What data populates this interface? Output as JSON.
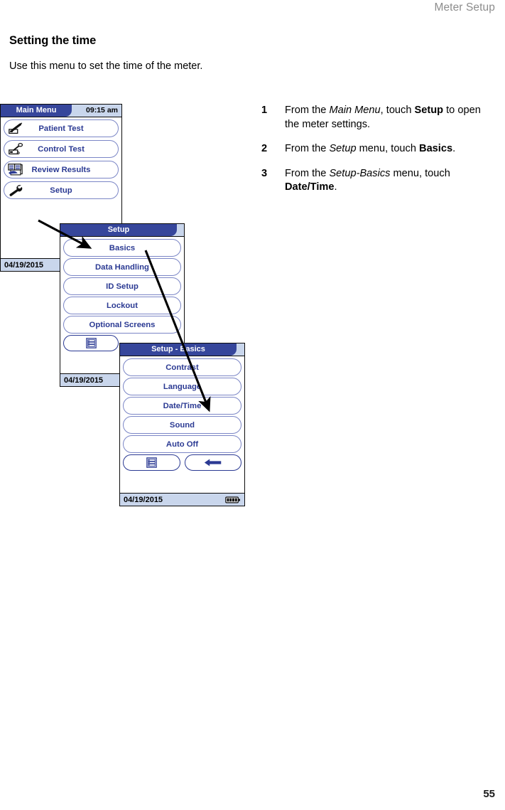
{
  "page": {
    "running_head": "Meter Setup",
    "number": "55",
    "section_title": "Setting the time",
    "intro": "Use this menu to set the time of the meter."
  },
  "steps": [
    {
      "num": "1",
      "parts": [
        {
          "t": "From the ",
          "s": "plain"
        },
        {
          "t": "Main Menu",
          "s": "italic"
        },
        {
          "t": ", touch ",
          "s": "plain"
        },
        {
          "t": "Setup",
          "s": "bold"
        },
        {
          "t": " to open the meter settings.",
          "s": "plain"
        }
      ]
    },
    {
      "num": "2",
      "parts": [
        {
          "t": "From the ",
          "s": "plain"
        },
        {
          "t": "Setup",
          "s": "italic"
        },
        {
          "t": " menu, touch ",
          "s": "plain"
        },
        {
          "t": "Basics",
          "s": "bold"
        },
        {
          "t": ".",
          "s": "plain"
        }
      ]
    },
    {
      "num": "3",
      "parts": [
        {
          "t": "From the ",
          "s": "plain"
        },
        {
          "t": "Setup-Basics",
          "s": "italic"
        },
        {
          "t": " menu, touch ",
          "s": "plain"
        },
        {
          "t": "Date/Time",
          "s": "bold"
        },
        {
          "t": ".",
          "s": "plain"
        }
      ]
    }
  ],
  "colors": {
    "title_bar": "#36469b",
    "title_bar_bg": "#c9d6ec",
    "button_text": "#2b3a93",
    "button_border": "#7b86c6",
    "status_bar": "#c9d6ec",
    "running_head": "#8d8d8d"
  },
  "screens": [
    {
      "id": "main",
      "title": "Main Menu",
      "clock": "09:15 am",
      "date": "04/19/2015",
      "has_battery": false,
      "buttons": [
        {
          "label": "Patient Test",
          "icon": "lancet-strip-icon"
        },
        {
          "label": "Control Test",
          "icon": "control-solution-strip-icon"
        },
        {
          "label": "Review Results",
          "icon": "logbook-icon"
        },
        {
          "label": "Setup",
          "icon": "wrench-icon"
        }
      ],
      "icon_buttons": []
    },
    {
      "id": "setup",
      "title": "Setup",
      "clock": "",
      "date": "04/19/2015",
      "has_battery": false,
      "buttons": [
        {
          "label": "Basics",
          "icon": ""
        },
        {
          "label": "Data Handling",
          "icon": ""
        },
        {
          "label": "ID Setup",
          "icon": ""
        },
        {
          "label": "Lockout",
          "icon": ""
        },
        {
          "label": "Optional Screens",
          "icon": ""
        }
      ],
      "icon_buttons": [
        {
          "icon": "main-menu-list-icon"
        }
      ]
    },
    {
      "id": "basics",
      "title": "Setup - Basics",
      "clock": "",
      "date": "04/19/2015",
      "has_battery": true,
      "buttons": [
        {
          "label": "Contrast",
          "icon": ""
        },
        {
          "label": "Language",
          "icon": ""
        },
        {
          "label": "Date/Time",
          "icon": ""
        },
        {
          "label": "Sound",
          "icon": ""
        },
        {
          "label": "Auto Off",
          "icon": ""
        }
      ],
      "icon_buttons": [
        {
          "icon": "main-menu-list-icon"
        },
        {
          "icon": "back-arrow-icon"
        }
      ]
    }
  ],
  "callout_arrows": [
    {
      "name": "arrow-setup-to-basics",
      "from": "Setup button on Main Menu",
      "to": "Basics button on Setup menu"
    },
    {
      "name": "arrow-basics-to-datetime",
      "from": "Basics button on Setup menu",
      "to": "Date/Time button on Setup - Basics menu"
    }
  ]
}
